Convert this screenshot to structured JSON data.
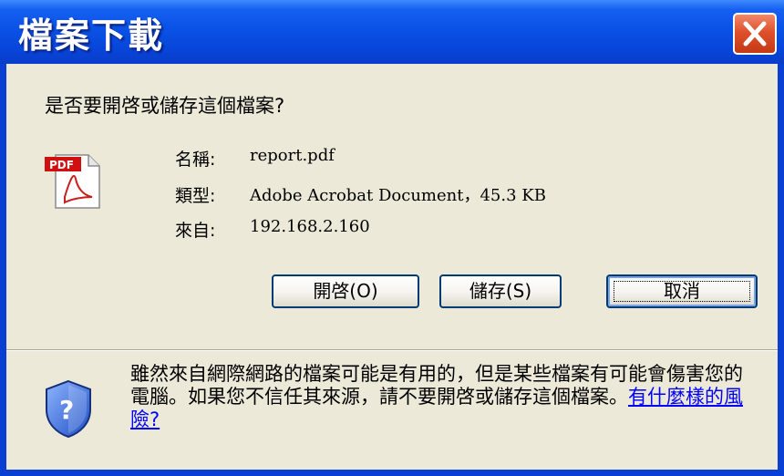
{
  "window": {
    "title": "檔案下載"
  },
  "dialog": {
    "question": "是否要開啓或儲存這個檔案?",
    "file": {
      "name_label": "名稱:",
      "name_value": "report.pdf",
      "type_label": "類型:",
      "type_value": "Adobe Acrobat Document，45.3 KB",
      "from_label": "來自:",
      "from_value": "192.168.2.160"
    },
    "buttons": {
      "open": "開啓(O)",
      "save": "儲存(S)",
      "cancel": "取消"
    },
    "icon_badge": "PDF",
    "warning_text": "雖然來自網際網路的檔案可能是有用的，但是某些檔案有可能會傷害您的電腦。如果您不信任其來源，請不要開啓或儲存這個檔案。",
    "warning_link": "有什麼樣的風險?"
  },
  "colors": {
    "titlebar": "#0a52e6",
    "close_button": "#e0502c",
    "dialog_background": "#ece9d8",
    "button_border": "#003c74",
    "link": "#0000ff"
  }
}
